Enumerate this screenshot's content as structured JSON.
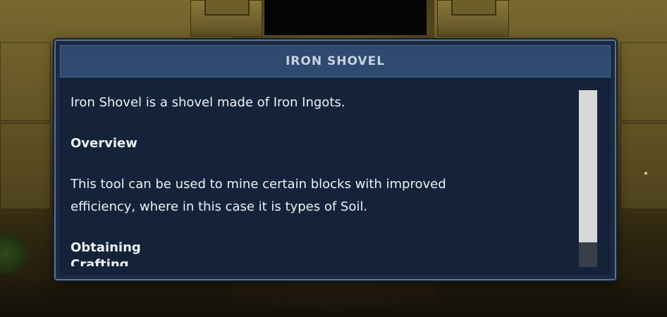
{
  "dialog": {
    "title": "IRON SHOVEL",
    "intro": "Iron Shovel is a shovel made of Iron Ingots.",
    "overview_heading": "Overview",
    "overview_line1": "This tool can be used to mine certain blocks with improved",
    "overview_line2": "efficiency, where in this case it is types of Soil.",
    "obtaining_heading": "Obtaining",
    "crafting_heading": "Crafting"
  },
  "scrollbar": {
    "position_fraction": 0.0,
    "visible_fraction": 0.86
  },
  "colors": {
    "dialog_bg": "#15233a",
    "header_bg": "#2f4a6f",
    "title_text": "#c9d3df",
    "body_text": "#eef1f5"
  }
}
